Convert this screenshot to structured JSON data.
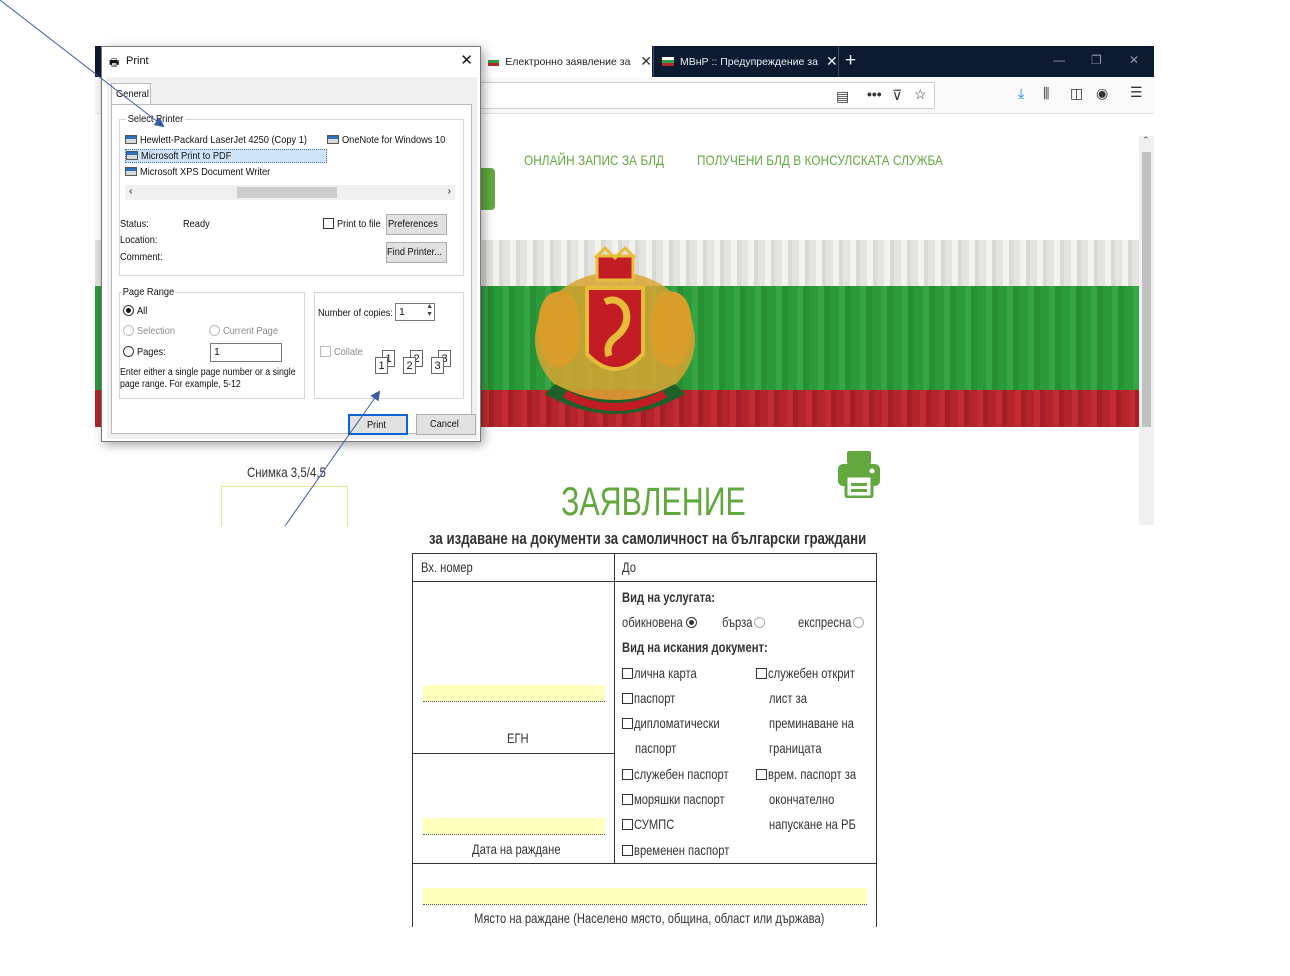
{
  "browser": {
    "tabs": [
      {
        "label": "Електронно заявление за изда...",
        "active": true
      },
      {
        "label": "МВнР :: Предупреждение за п...",
        "active": false
      }
    ],
    "new_tab_symbol": "+",
    "window_controls": {
      "minimize": "—",
      "restore": "❐",
      "close": "✕"
    }
  },
  "site": {
    "nav_links": [
      "ОНЛАЙН ЗАПИС ЗА БЛД",
      "ПОЛУЧЕНИ БЛД В КОНСУЛСКАТА СЛУЖБА"
    ],
    "flag_colors": {
      "white": "#eeeeea",
      "green": "#2f9e3f",
      "red": "#b8262d"
    },
    "accent_color": "#62a83f",
    "caption": "Снимка 3,5/4,5",
    "document_title": "ЗАЯВЛЕНИЕ",
    "document_subtitle": "за издаване на документи за самоличност на български граждани"
  },
  "form": {
    "header_left": "Вх. номер",
    "header_right": "До",
    "service_type_label": "Вид на услугата:",
    "service_options": [
      {
        "label": "обикновена",
        "selected": true
      },
      {
        "label": "бърза",
        "selected": false
      },
      {
        "label": "експресна",
        "selected": false
      }
    ],
    "document_type_label": "Вид на искания документ:",
    "doc_left": [
      "лична карта",
      "паспорт",
      "дипломатически",
      "паспорт",
      "служебен паспорт",
      "моряшки паспорт",
      "СУМПС",
      "временен паспорт"
    ],
    "doc_right": [
      "служебен открит",
      "лист за",
      "преминаване на",
      "границата",
      "врем. паспорт за",
      "окончателно",
      "напускане на РБ"
    ],
    "egn_label": "ЕГН",
    "dob_label": "Дата на раждане",
    "birthplace_label": "Място на раждане (Населено място, община, област или държава)"
  },
  "print_dialog": {
    "title": "Print",
    "tab": "General",
    "select_printer_label": "Select Printer",
    "printers": [
      "Hewlett-Packard LaserJet 4250 (Copy 1)",
      "OneNote for Windows 10",
      "Microsoft Print to PDF",
      "Microsoft XPS Document Writer"
    ],
    "selected_printer": "Microsoft Print to PDF",
    "status_label": "Status:",
    "status_value": "Ready",
    "location_label": "Location:",
    "comment_label": "Comment:",
    "print_to_file": "Print to file",
    "preferences": "Preferences",
    "find_printer": "Find Printer...",
    "page_range_label": "Page Range",
    "all": "All",
    "selection": "Selection",
    "current_page": "Current Page",
    "pages": "Pages:",
    "pages_value": "1",
    "hint": [
      "Enter either a single page number or a single",
      "page range.  For example, 5-12"
    ],
    "copies_label": "Number of copies:",
    "copies_value": "1",
    "collate": "Collate",
    "collate_pages": [
      "1",
      "1",
      "2",
      "2",
      "3",
      "3"
    ],
    "print_button": "Print",
    "cancel_button": "Cancel"
  },
  "annotation_color": "#3b5ba8"
}
